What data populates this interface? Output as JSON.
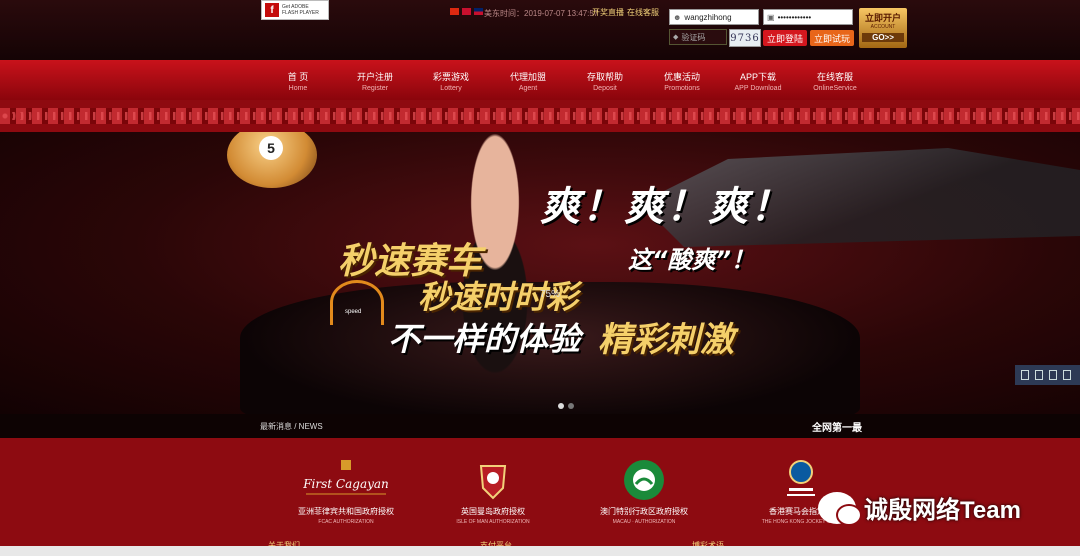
{
  "header": {
    "flash_badge": {
      "line1": "Get ADOBE",
      "line2": "FLASH PLAYER"
    },
    "time_label": "美东时间：2019-07-07 13:47:57",
    "links": [
      "开奖直播",
      "在线客服"
    ],
    "login": {
      "username_value": "wangzhihong",
      "password_value": "••••••••••••",
      "captcha_placeholder": "验证码",
      "captcha_code": "9736",
      "login_button": "立即登陆",
      "trial_button": "立即试玩"
    },
    "open_account": {
      "line1": "立即开户",
      "line2": "ACCOUNT",
      "line3": "GO>>"
    }
  },
  "nav": [
    {
      "zh": "首 页",
      "en": "Home"
    },
    {
      "zh": "开户注册",
      "en": "Register"
    },
    {
      "zh": "彩票游戏",
      "en": "Lottery"
    },
    {
      "zh": "代理加盟",
      "en": "Agent"
    },
    {
      "zh": "存取帮助",
      "en": "Deposit"
    },
    {
      "zh": "优惠活动",
      "en": "Promotions"
    },
    {
      "zh": "APP下载",
      "en": "APP Download"
    },
    {
      "zh": "在线客服",
      "en": "OnlineService"
    }
  ],
  "banner": {
    "ball_number": "5",
    "line_shuang": "爽！爽！爽！",
    "line_suan": "这“酸爽”！",
    "line_race": "秒速赛车",
    "line_ssc": "秒速时时彩",
    "line_exp_white": "不一样的体验",
    "line_exp_gold": "精彩刺激",
    "speed_text": "speed",
    "pct_text": "75%"
  },
  "news": {
    "label": "最新消息 / NEWS",
    "right": "全网第一最"
  },
  "authorities": [
    {
      "zh": "亚洲菲律宾共和国政府授权",
      "en": "FCAC  AUTHORIZATION",
      "logo": "first-cagayan-logo"
    },
    {
      "zh": "英国曼岛政府授权",
      "en": "ISLE OF MAN AUTHORIZATION",
      "logo": "isle-of-man-crest"
    },
    {
      "zh": "澳门特别行政区政府授权",
      "en": "MACAU · AUTHORIZATION",
      "logo": "macau-emblem"
    },
    {
      "zh": "香港赛马会指定授",
      "en": "THE HONG KONG JOCKEY CLUB",
      "logo": "hkjc-emblem"
    }
  ],
  "footer_links": [
    "关于我们",
    "支付平台",
    "博彩术语"
  ],
  "watermark": {
    "text": "诚殷网络Team"
  },
  "colors": {
    "brand_red": "#c9121b",
    "gold": "#f5d06a",
    "dark": "#1a0507"
  }
}
